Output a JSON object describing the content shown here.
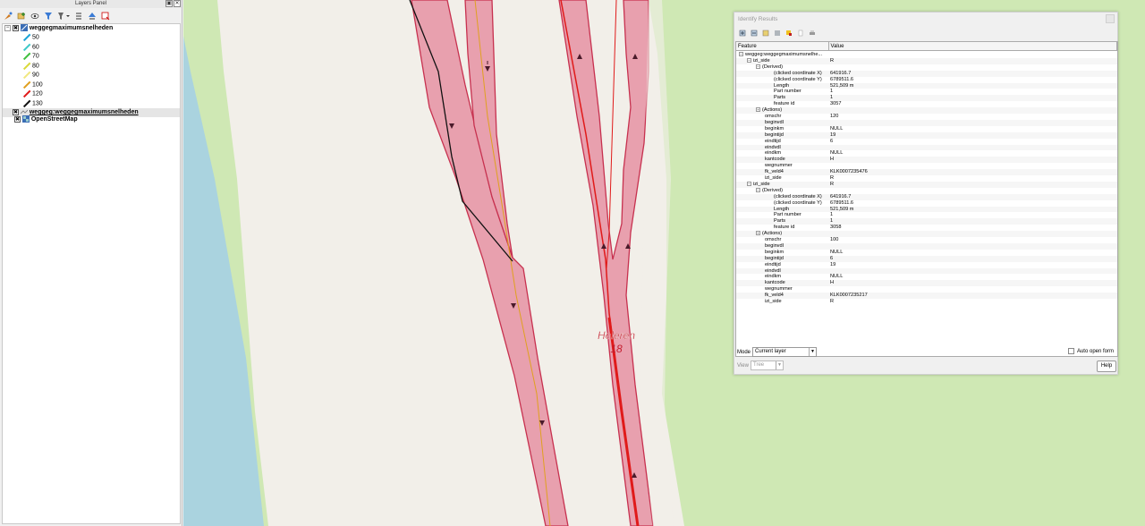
{
  "layers_panel": {
    "title": "Layers Panel",
    "layers": [
      {
        "name": "weggegmaximumsnelheden",
        "checked": true
      },
      {
        "name": "weggeg:weggegmaximumsnelheden",
        "checked": true
      },
      {
        "name": "OpenStreetMap",
        "checked": true
      }
    ],
    "legend": [
      {
        "label": "50",
        "color": "#1aa3d6"
      },
      {
        "label": "60",
        "color": "#3ec8c8"
      },
      {
        "label": "70",
        "color": "#3fbf3f"
      },
      {
        "label": "80",
        "color": "#d9d93a"
      },
      {
        "label": "90",
        "color": "#f2e880"
      },
      {
        "label": "100",
        "color": "#e0a020"
      },
      {
        "label": "120",
        "color": "#e01a1a"
      },
      {
        "label": "130",
        "color": "#111111"
      }
    ]
  },
  "map": {
    "label_name": "Heleren",
    "label_number": "18",
    "colors": {
      "grass": "#cfe8b4",
      "water": "#aad3df",
      "ground": "#f2efe9",
      "road_fill": "#e8a0ae",
      "road_edge": "#c7314f"
    }
  },
  "identify": {
    "title": "Identify Results",
    "columns": [
      "Feature",
      "Value"
    ],
    "root": "weggeg:weggegmaximumsnelhe...",
    "features": [
      {
        "name": "izi_side",
        "value": "R",
        "derived": [
          [
            "(clicked coordinate X)",
            "641916.7"
          ],
          [
            "(clicked coordinate Y)",
            "6789511.6"
          ],
          [
            "Length",
            "521,509 m"
          ],
          [
            "Part number",
            "1"
          ],
          [
            "Parts",
            "1"
          ],
          [
            "feature id",
            "3057"
          ]
        ],
        "attributes": [
          [
            "omschr",
            "120"
          ],
          [
            "beginvdl",
            ""
          ],
          [
            "beginkm",
            "NULL"
          ],
          [
            "begintijd",
            "19"
          ],
          [
            "eindtijd",
            "6"
          ],
          [
            "eindvdl",
            ""
          ],
          [
            "eindkm",
            "NULL"
          ],
          [
            "kantcode",
            "H"
          ],
          [
            "wegnummer",
            ""
          ],
          [
            "fk_veld4",
            "KLK0007235476"
          ],
          [
            "izi_side",
            "R"
          ]
        ]
      },
      {
        "name": "izi_side",
        "value": "R",
        "derived": [
          [
            "(clicked coordinate X)",
            "641916.7"
          ],
          [
            "(clicked coordinate Y)",
            "6789511.6"
          ],
          [
            "Length",
            "521,509 m"
          ],
          [
            "Part number",
            "1"
          ],
          [
            "Parts",
            "1"
          ],
          [
            "feature id",
            "3058"
          ]
        ],
        "attributes": [
          [
            "omschr",
            "100"
          ],
          [
            "beginvdl",
            ""
          ],
          [
            "beginkm",
            "NULL"
          ],
          [
            "begintijd",
            "6"
          ],
          [
            "eindtijd",
            "19"
          ],
          [
            "eindvdl",
            ""
          ],
          [
            "eindkm",
            "NULL"
          ],
          [
            "kantcode",
            "H"
          ],
          [
            "wegnummer",
            ""
          ],
          [
            "fk_veld4",
            "KLK0007235217"
          ],
          [
            "izi_side",
            "R"
          ]
        ]
      }
    ],
    "derived_label": "(Derived)",
    "actions_label": "(Actions)",
    "mode_label": "Mode",
    "mode_value": "Current layer",
    "view_label": "View",
    "view_value": "Tree",
    "auto_open_label": "Auto open form",
    "help_label": "Help"
  }
}
